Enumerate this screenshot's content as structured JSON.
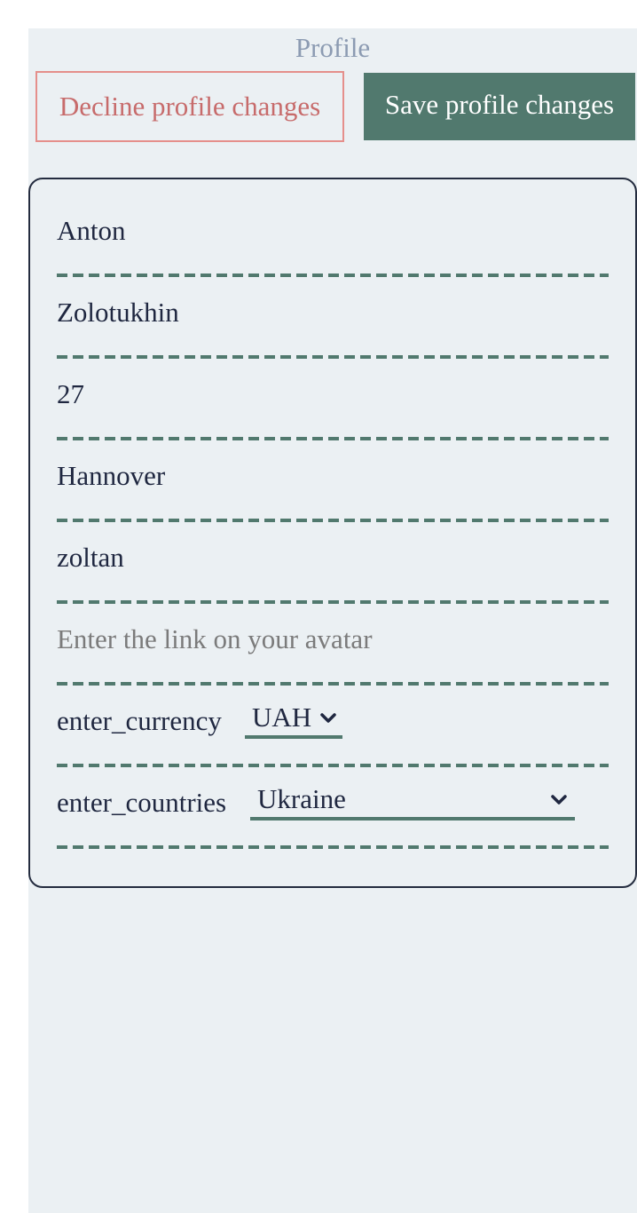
{
  "header": {
    "title": "Profile"
  },
  "actions": {
    "decline_label": "Decline profile changes",
    "save_label": "Save profile changes"
  },
  "form": {
    "first_name": {
      "value": "Anton"
    },
    "last_name": {
      "value": "Zolotukhin"
    },
    "age": {
      "value": "27"
    },
    "city": {
      "value": "Hannover"
    },
    "username": {
      "value": "zoltan"
    },
    "avatar_link": {
      "value": "",
      "placeholder": "Enter the link on your avatar"
    },
    "currency": {
      "label": "enter_currency",
      "selected": "UAH"
    },
    "country": {
      "label": "enter_countries",
      "selected": "Ukraine"
    }
  },
  "icons": {
    "dropdown": "chevron-down-icon"
  },
  "colors": {
    "background": "#ebf0f3",
    "accent": "#51796e",
    "decline": "#e58f8b",
    "text": "#1f2740",
    "title": "#8c9bb2"
  }
}
